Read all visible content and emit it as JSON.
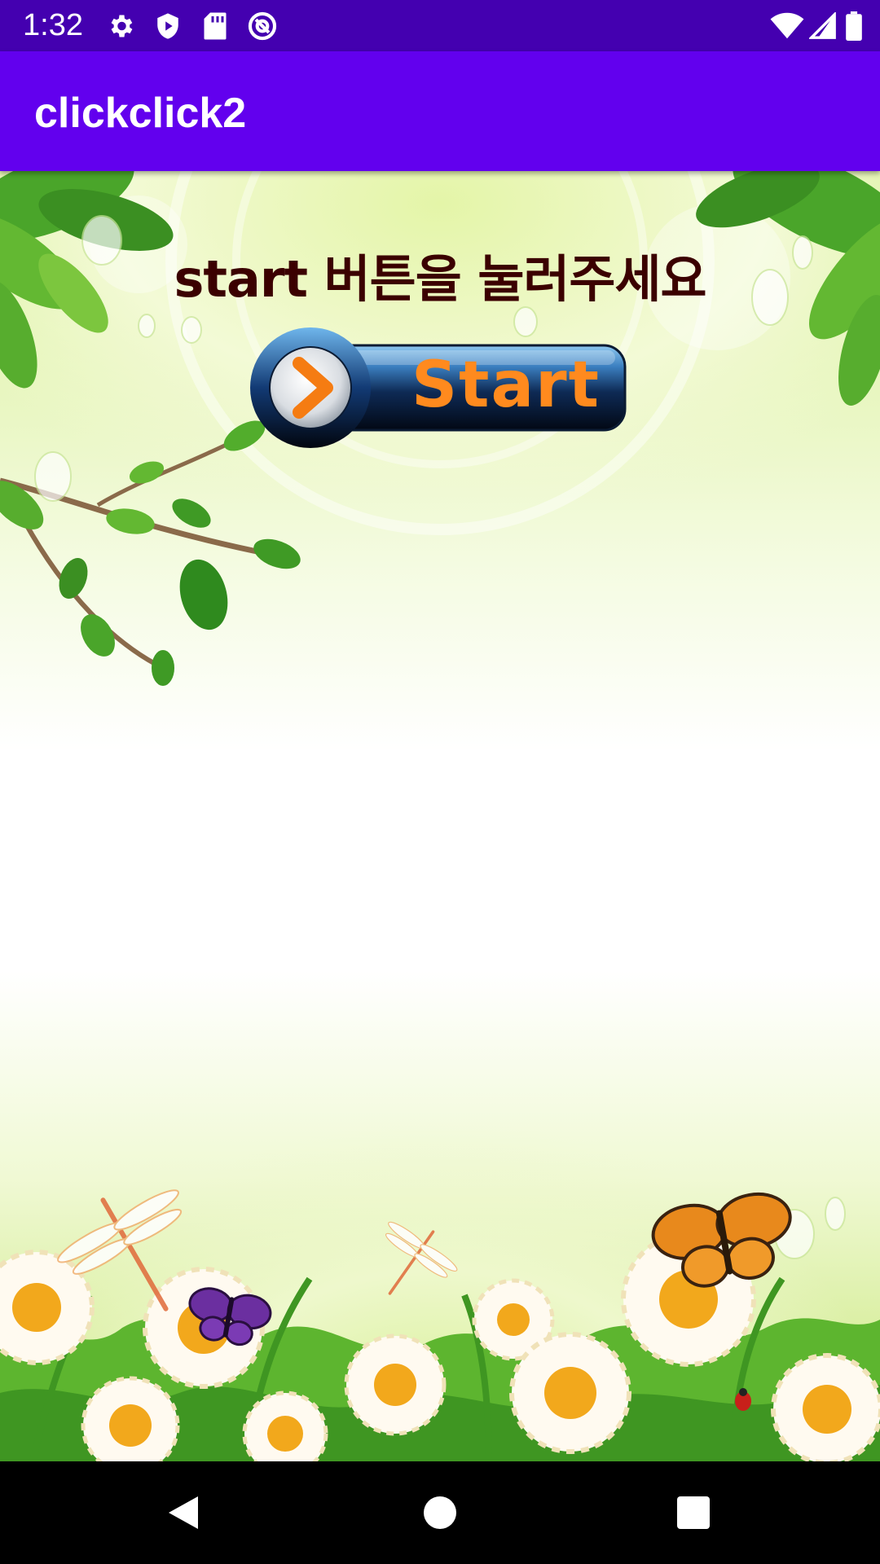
{
  "status_bar": {
    "time": "1:32",
    "left_icons": [
      "gear-icon",
      "play-protect-icon",
      "sd-card-icon",
      "at-sign-icon"
    ],
    "right_icons": [
      "wifi-icon",
      "cellular-signal-icon",
      "battery-icon"
    ],
    "background": "#4400b0"
  },
  "app_bar": {
    "title": "clickclick2",
    "background": "#6200ee"
  },
  "main": {
    "instruction": "start 버튼을 눌러주세요",
    "start_button_label": "Start",
    "instruction_color": "#3b0000",
    "button_text_color": "#ff8a1e"
  },
  "nav_bar": {
    "icons": [
      "back-icon",
      "home-icon",
      "recents-icon"
    ]
  }
}
